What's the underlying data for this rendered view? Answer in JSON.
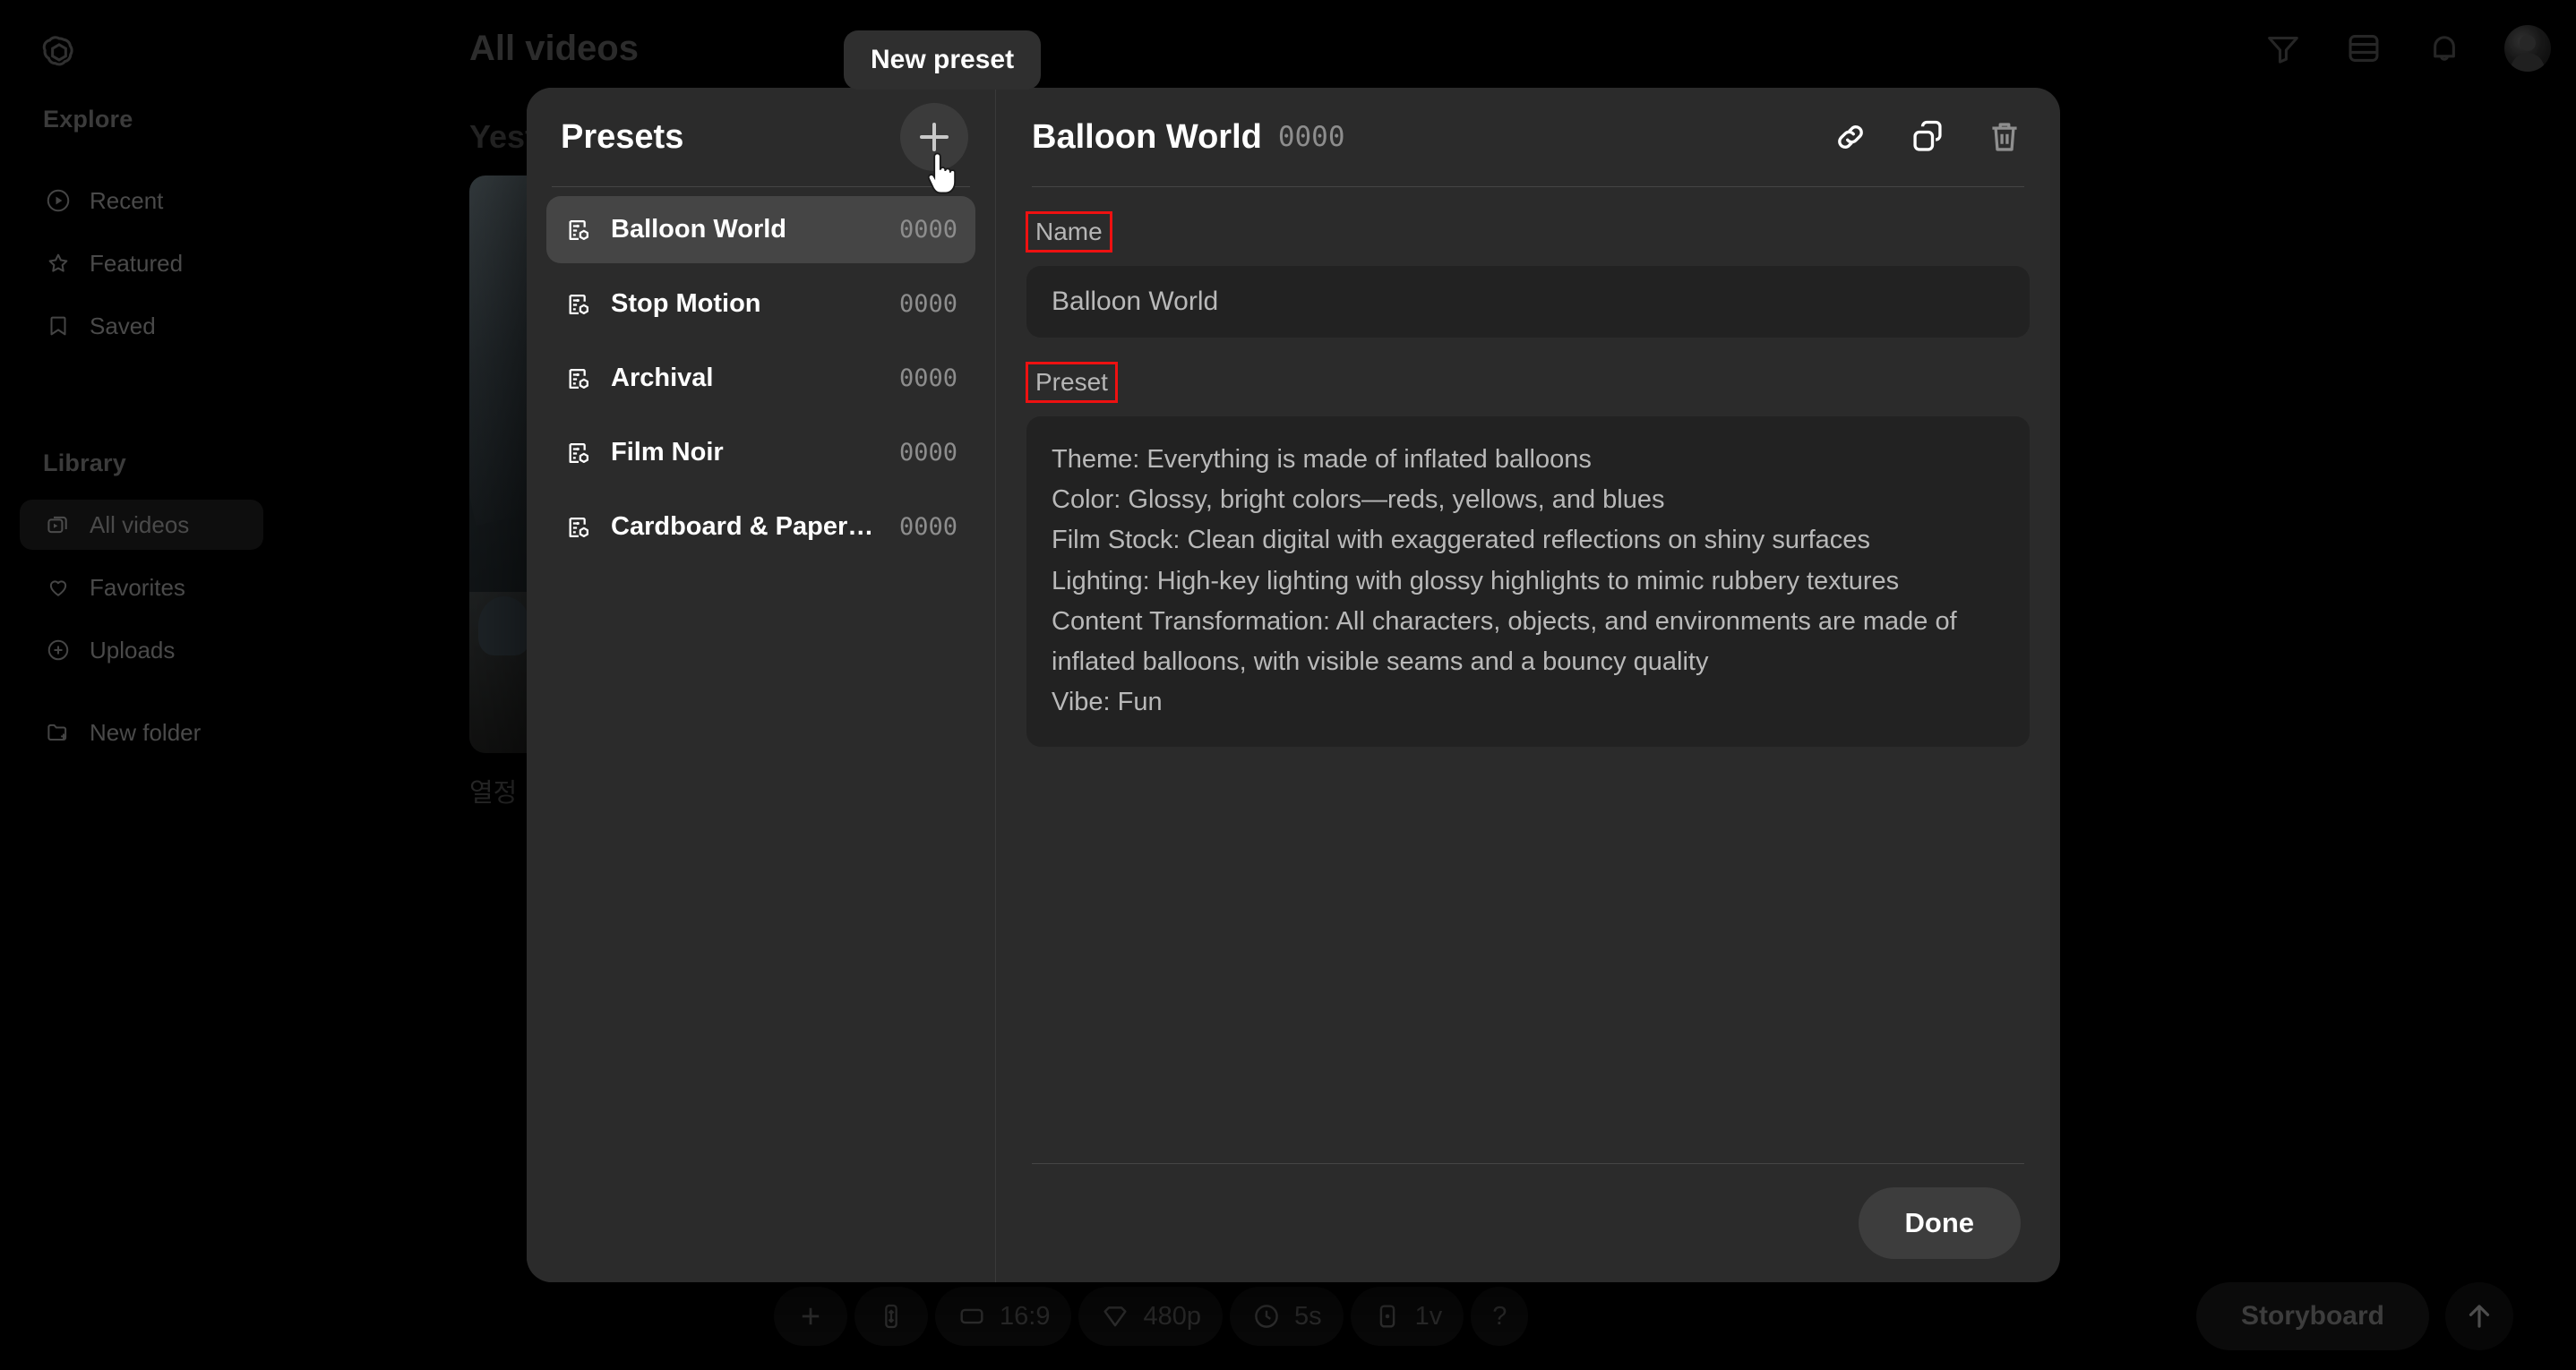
{
  "app": {
    "logo_icon": "openai-logo-icon"
  },
  "sidebar": {
    "sections": [
      {
        "label": "Explore"
      },
      {
        "label": "Library"
      }
    ],
    "explore_items": [
      {
        "label": "Recent",
        "icon": "play-circle-icon"
      },
      {
        "label": "Featured",
        "icon": "star-icon"
      },
      {
        "label": "Saved",
        "icon": "bookmark-icon"
      }
    ],
    "library_items": [
      {
        "label": "All videos",
        "icon": "videos-stack-icon",
        "active": true
      },
      {
        "label": "Favorites",
        "icon": "heart-icon",
        "active": false
      },
      {
        "label": "Uploads",
        "icon": "plus-circle-icon",
        "active": false
      },
      {
        "label": "New folder",
        "icon": "folder-plus-icon",
        "active": false
      }
    ]
  },
  "header": {
    "page_title": "All videos",
    "icons": [
      {
        "name": "filter-icon"
      },
      {
        "name": "layout-list-icon"
      },
      {
        "name": "bell-icon"
      }
    ],
    "avatar": "user-avatar"
  },
  "content": {
    "day_header": "Yesterday",
    "thumb_caption": "열정"
  },
  "tooltip": {
    "text": "New preset"
  },
  "modal": {
    "presets_panel": {
      "title": "Presets",
      "add_button": "new-preset-button",
      "items": [
        {
          "name": "Balloon World",
          "count": "0000",
          "selected": true
        },
        {
          "name": "Stop Motion",
          "count": "0000",
          "selected": false
        },
        {
          "name": "Archival",
          "count": "0000",
          "selected": false
        },
        {
          "name": "Film Noir",
          "count": "0000",
          "selected": false
        },
        {
          "name": "Cardboard & Paperc...",
          "count": "0000",
          "selected": false
        }
      ]
    },
    "detail": {
      "title": "Balloon World",
      "count": "0000",
      "actions": [
        {
          "name": "link-icon"
        },
        {
          "name": "duplicate-icon"
        },
        {
          "name": "trash-icon"
        }
      ],
      "name_label": "Name",
      "name_value": "Balloon World",
      "name_placeholder": "Name",
      "preset_label": "Preset",
      "preset_value": "Theme: Everything is made of inflated balloons\nColor: Glossy, bright colors—reds, yellows, and blues\nFilm Stock: Clean digital with exaggerated reflections on shiny surfaces\nLighting: High-key lighting with glossy highlights to mimic rubbery textures\nContent Transformation: All characters, objects, and environments are made of inflated balloons, with visible seams and a bouncy quality\nVibe: Fun",
      "preset_placeholder": "Preset",
      "done_label": "Done"
    }
  },
  "bottom_toolbar": {
    "chips": [
      {
        "label": "",
        "icon": "plus-icon"
      },
      {
        "label": "",
        "icon": "remix-icon"
      },
      {
        "label": "16:9",
        "icon": "aspect-ratio-icon"
      },
      {
        "label": "480p",
        "icon": "resolution-icon"
      },
      {
        "label": "5s",
        "icon": "clock-icon"
      },
      {
        "label": "1v",
        "icon": "variations-icon"
      },
      {
        "label": "?",
        "icon": "help-icon"
      }
    ],
    "storyboard_label": "Storyboard",
    "send_button": "send-button"
  },
  "annotations": {
    "highlight_color": "#ee1111",
    "boxed_labels": [
      "Name",
      "Preset"
    ]
  }
}
